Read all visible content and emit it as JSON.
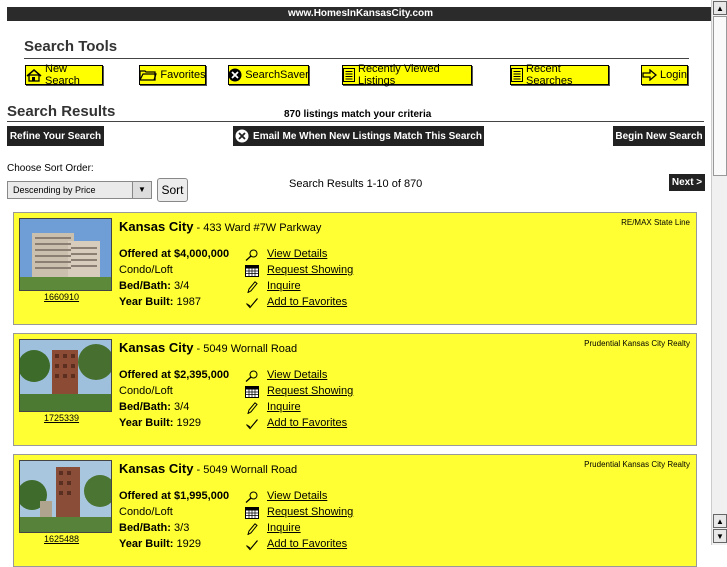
{
  "header": {
    "site": "www.HomesInKansasCity.com"
  },
  "search_tools": {
    "title": "Search Tools",
    "buttons": [
      {
        "label": "New Search",
        "icon": "house-icon"
      },
      {
        "label": "Favorites",
        "icon": "folder-icon"
      },
      {
        "label": "SearchSaver",
        "icon": "searchsaver-icon"
      },
      {
        "label": "Recently Viewed Listings",
        "icon": "list-icon"
      },
      {
        "label": "Recent Searches",
        "icon": "list-icon"
      },
      {
        "label": "Login",
        "icon": "arrow-right-icon"
      }
    ]
  },
  "results": {
    "title": "Search Results",
    "match_count": "870 listings match your criteria",
    "refine_label": "Refine Your Search",
    "email_label": "Email Me When New Listings Match This Search",
    "new_search_label": "Begin New Search",
    "sort_label": "Choose Sort Order:",
    "sort_value": "Descending by Price",
    "sort_button": "Sort",
    "range": "Search Results 1-10 of 870",
    "next_label": "Next >"
  },
  "link_labels": {
    "details": "View Details",
    "showing": "Request Showing",
    "inquire": "Inquire",
    "favorites": "Add to Favorites"
  },
  "field_labels": {
    "bedbath": "Bed/Bath:",
    "year": "Year Built:"
  },
  "listings": [
    {
      "mls": "1660910",
      "city": "Kansas City",
      "address": " - 433 Ward #7W Parkway",
      "agency": "RE/MAX State Line",
      "price": "Offered at $4,000,000",
      "type": "Condo/Loft",
      "bedbath": "3/4",
      "year": "1987"
    },
    {
      "mls": "1725339",
      "city": "Kansas City",
      "address": " - 5049 Wornall Road",
      "agency": "Prudential Kansas City Realty",
      "price": "Offered at $2,395,000",
      "type": "Condo/Loft",
      "bedbath": "3/4",
      "year": "1929"
    },
    {
      "mls": "1625488",
      "city": "Kansas City",
      "address": " - 5049 Wornall Road",
      "agency": "Prudential Kansas City Realty",
      "price": "Offered at $1,995,000",
      "type": "Condo/Loft",
      "bedbath": "3/3",
      "year": "1929"
    }
  ],
  "colors": {
    "listing_bg": "#ffff33",
    "button_bg": "#ffff00",
    "dark": "#222222"
  }
}
